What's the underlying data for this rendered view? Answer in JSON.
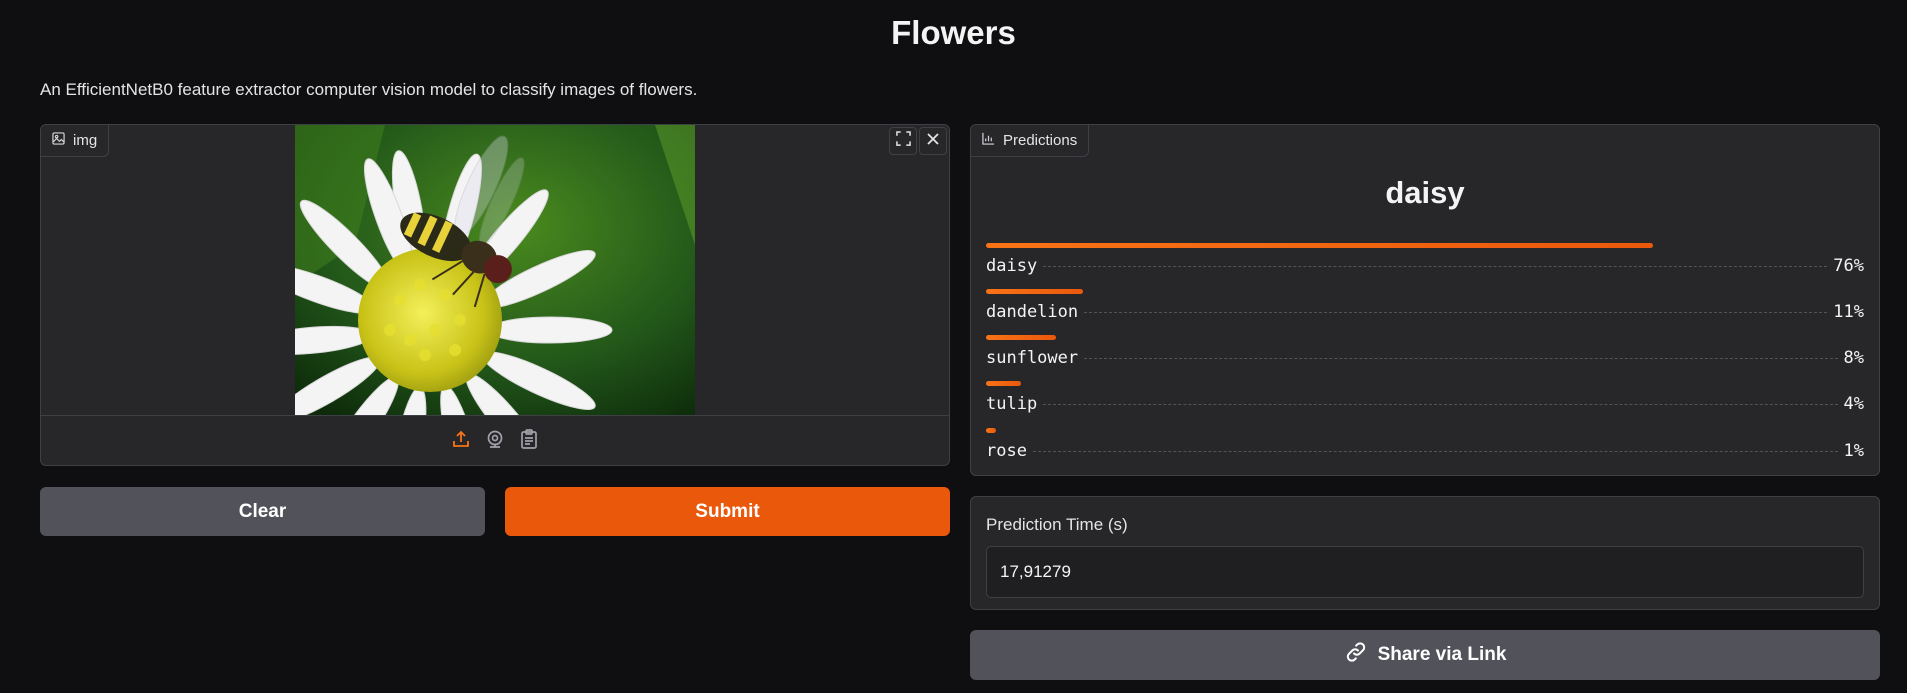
{
  "page": {
    "title": "Flowers",
    "description": "An EfficientNetB0 feature extractor computer vision model to classify images of flowers."
  },
  "image_input": {
    "label": "img",
    "icons": {
      "label": "image-icon",
      "fullscreen": "fullscreen-icon",
      "close": "close-icon",
      "upload": "upload-icon",
      "webcam": "webcam-icon",
      "clipboard": "clipboard-icon"
    }
  },
  "buttons": {
    "clear": "Clear",
    "submit": "Submit",
    "share": "Share via Link"
  },
  "predictions": {
    "label": "Predictions",
    "top_label": "daisy",
    "items": [
      {
        "name": "daisy",
        "percent": "76%",
        "confidence": 0.76
      },
      {
        "name": "dandelion",
        "percent": "11%",
        "confidence": 0.11
      },
      {
        "name": "sunflower",
        "percent": "8%",
        "confidence": 0.08
      },
      {
        "name": "tulip",
        "percent": "4%",
        "confidence": 0.04
      },
      {
        "name": "rose",
        "percent": "1%",
        "confidence": 0.01
      }
    ]
  },
  "prediction_time": {
    "label": "Prediction Time (s)",
    "value": "17,91279"
  },
  "colors": {
    "accent": "#ea580c",
    "background": "#0f0f11",
    "panel": "#27272a",
    "secondary_button": "#52525b"
  }
}
